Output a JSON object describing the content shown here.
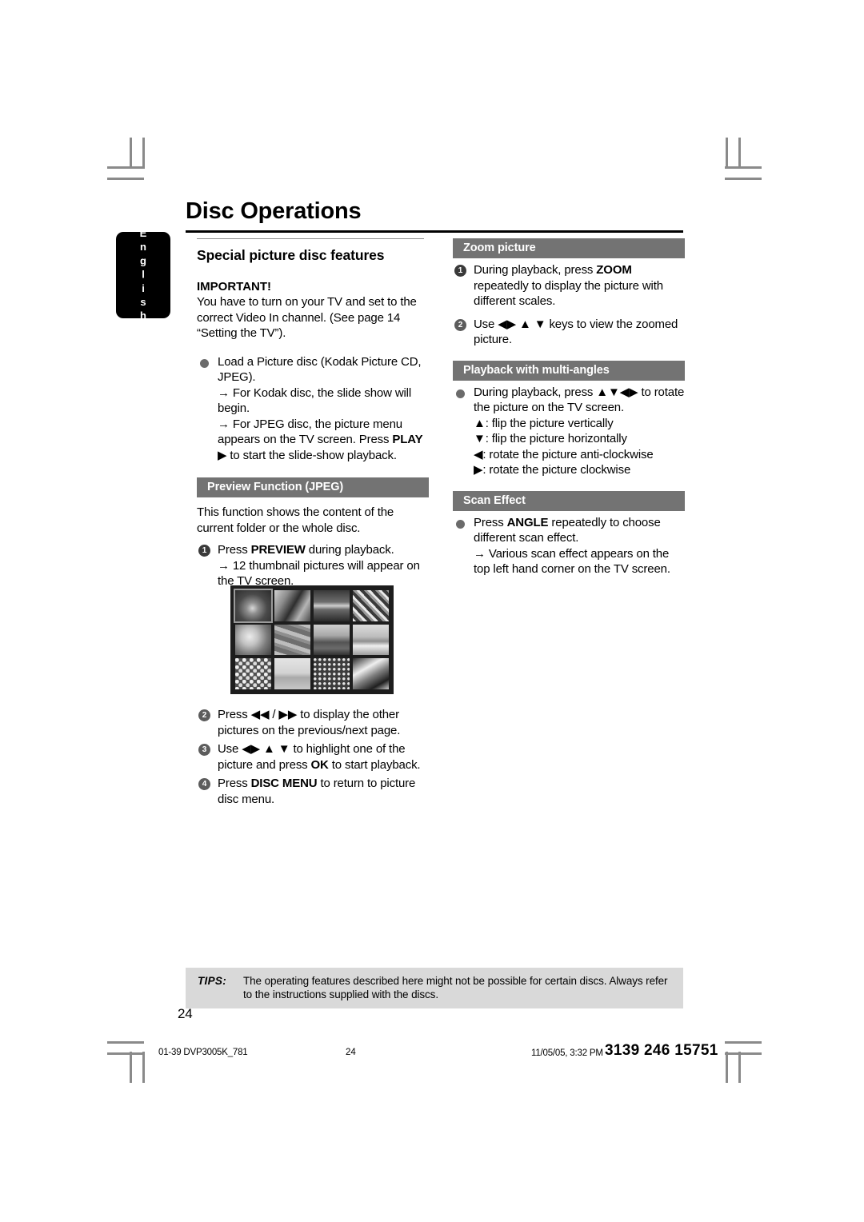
{
  "document": {
    "title": "Disc Operations",
    "language_tab": "English",
    "page_number": "24"
  },
  "left_column": {
    "section_title": "Special picture disc features",
    "important_heading": "IMPORTANT!",
    "important_body": "You have to turn on your TV and set to the correct Video In channel.  (See page 14 “Setting the TV”).",
    "load_disc": {
      "text": "Load a Picture disc (Kodak Picture CD, JPEG).",
      "note_1": "→ For Kodak disc, the slide show will begin.",
      "note_2_before": "→ For JPEG disc, the picture menu appears on the TV screen. Press ",
      "note_2_bold": "PLAY",
      "note_2_after": " ▶ to start the slide-show playback."
    },
    "preview": {
      "bar": "Preview Function (JPEG)",
      "intro": "This function shows the content of the current folder or the whole disc.",
      "steps": [
        {
          "num": "1",
          "before": "Press ",
          "bold": "PREVIEW",
          "after": " during playback.",
          "note": "→ 12 thumbnail pictures will appear on the TV screen."
        },
        {
          "num": "2",
          "before": "Press ◀◀ / ▶▶ to display the other pictures on the previous/next page.",
          "bold": "",
          "after": "",
          "note": ""
        },
        {
          "num": "3",
          "before": "Use ◀▶ ▲ ▼ to highlight one of the picture and press ",
          "bold": "OK",
          "after": " to start playback.",
          "note": ""
        },
        {
          "num": "4",
          "before": "Press ",
          "bold": "DISC MENU",
          "after": " to return to picture disc menu.",
          "note": ""
        }
      ]
    }
  },
  "right_column": {
    "zoom": {
      "bar": "Zoom picture",
      "steps": [
        {
          "num": "1",
          "before": "During playback, press ",
          "bold": "ZOOM",
          "after": " repeatedly to display the picture with different scales."
        },
        {
          "num": "2",
          "before": "Use ◀▶ ▲ ▼ keys to view the zoomed picture.",
          "bold": "",
          "after": ""
        }
      ]
    },
    "multi_angles": {
      "bar": "Playback with multi-angles",
      "body": "During playback, press ▲▼◀▶ to rotate the picture on the TV screen.",
      "lines": [
        "▲: flip the picture vertically",
        "▼: flip the picture horizontally",
        "◀: rotate the picture anti-clockwise",
        "▶: rotate the picture clockwise"
      ]
    },
    "scan_effect": {
      "bar": "Scan Effect",
      "before": "Press ",
      "bold": "ANGLE",
      "after": " repeatedly to choose different scan effect.",
      "note": "→ Various scan effect appears on the top left hand corner on the TV screen."
    }
  },
  "tips": {
    "label": "TIPS:",
    "text": "The operating features described here might not be possible for certain discs.  Always refer to the instructions supplied with the discs."
  },
  "printer_footer": {
    "file": "01-39 DVP3005K_781",
    "page": "24",
    "date": "11/05/05, 3:32 PM",
    "code": "3139 246 15751"
  },
  "colors": {
    "section_bar": "#737373",
    "tips_band": "#d9d9d9",
    "tab": "#000000"
  }
}
